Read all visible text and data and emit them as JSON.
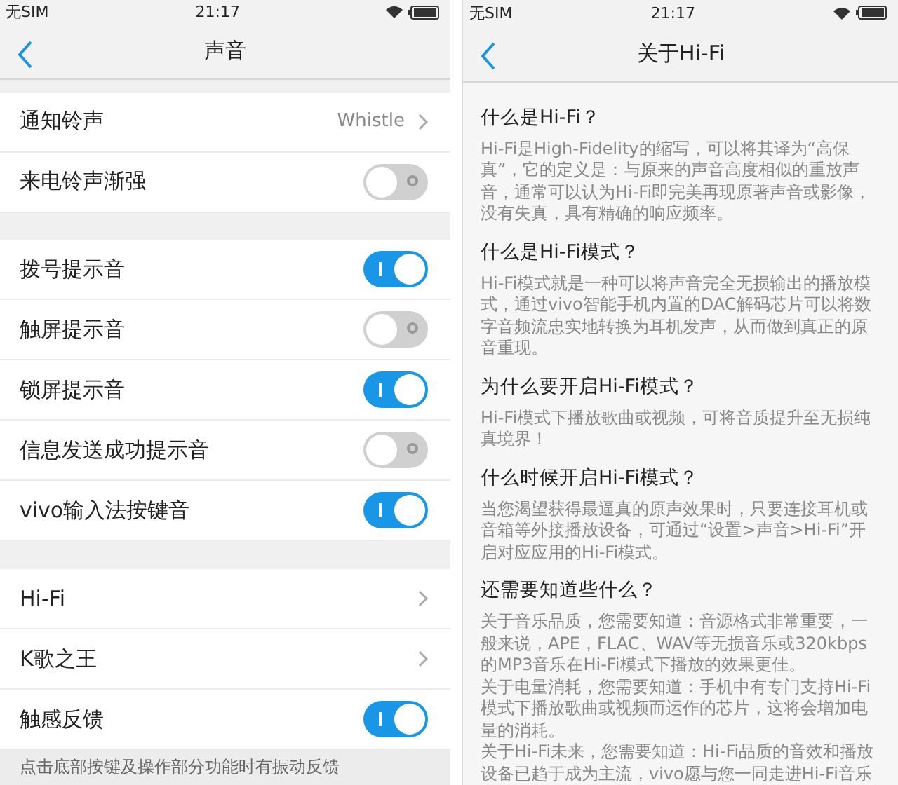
{
  "left": {
    "status_bar": {
      "carrier": "无SIM",
      "time": "21:17"
    },
    "title": "声音",
    "groups": [
      [
        {
          "kind": "value",
          "label": "通知铃声",
          "value": "Whistle"
        },
        {
          "kind": "toggle",
          "label": "来电铃声渐强",
          "on": false
        }
      ],
      [
        {
          "kind": "toggle",
          "label": "拨号提示音",
          "on": true
        },
        {
          "kind": "toggle",
          "label": "触屏提示音",
          "on": false
        },
        {
          "kind": "toggle",
          "label": "锁屏提示音",
          "on": true
        },
        {
          "kind": "toggle",
          "label": "信息发送成功提示音",
          "on": false
        },
        {
          "kind": "toggle",
          "label": "vivo输入法按键音",
          "on": true
        }
      ],
      [
        {
          "kind": "link",
          "label": "Hi-Fi"
        },
        {
          "kind": "link",
          "label": "K歌之王"
        },
        {
          "kind": "toggle",
          "label": "触感反馈",
          "on": true
        }
      ]
    ],
    "footer": "点击底部按键及操作部分功能时有振动反馈"
  },
  "right": {
    "status_bar": {
      "carrier": "无SIM",
      "time": "21:17"
    },
    "title": "关于Hi-Fi",
    "sections": [
      {
        "heading": "什么是Hi-Fi？",
        "paragraphs": [
          "Hi-Fi是High-Fidelity的缩写，可以将其译为“高保真”，它的定义是：与原来的声音高度相似的重放声音，通常可以认为Hi-Fi即完美再现原著声音或影像，没有失真，具有精确的响应频率。"
        ]
      },
      {
        "heading": "什么是Hi-Fi模式？",
        "paragraphs": [
          "Hi-Fi模式就是一种可以将声音完全无损输出的播放模式，通过vivo智能手机内置的DAC解码芯片可以将数字音频流忠实地转换为耳机发声，从而做到真正的原音重现。"
        ]
      },
      {
        "heading": "为什么要开启Hi-Fi模式？",
        "paragraphs": [
          "Hi-Fi模式下播放歌曲或视频，可将音质提升至无损纯真境界！"
        ]
      },
      {
        "heading": "什么时候开启Hi-Fi模式？",
        "paragraphs": [
          "当您渴望获得最逼真的原声效果时，只要连接耳机或音箱等外接播放设备，可通过“设置>声音>Hi-Fi”开启对应应用的Hi-Fi模式。"
        ]
      },
      {
        "heading": "还需要知道些什么？",
        "paragraphs": [
          "关于音乐品质，您需要知道：音源格式非常重要，一般来说，APE，FLAC、WAV等无损音乐或320kbps的MP3音乐在Hi-Fi模式下播放的效果更佳。",
          "关于电量消耗，您需要知道：手机中有专门支持Hi-Fi模式下播放歌曲或视频而运作的芯片，这将会增加电量的消耗。",
          "关于Hi-Fi未来，您需要知道：Hi-Fi品质的音效和播放设备已趋于成为主流，vivo愿与您一同走进Hi-Fi音乐"
        ]
      }
    ]
  }
}
